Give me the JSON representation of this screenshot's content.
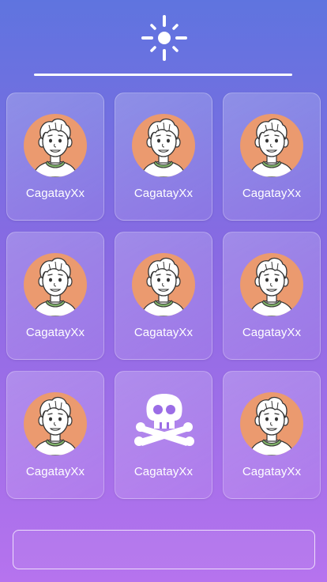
{
  "header": {
    "icon": "sun-icon",
    "divider": true
  },
  "players": [
    {
      "name": "CagatayXx",
      "avatar": "boy-avatar-icon",
      "status": "alive"
    },
    {
      "name": "CagatayXx",
      "avatar": "boy-avatar-icon",
      "status": "alive"
    },
    {
      "name": "CagatayXx",
      "avatar": "boy-avatar-icon",
      "status": "alive"
    },
    {
      "name": "CagatayXx",
      "avatar": "boy-avatar-icon",
      "status": "alive"
    },
    {
      "name": "CagatayXx",
      "avatar": "boy-avatar-icon",
      "status": "alive"
    },
    {
      "name": "CagatayXx",
      "avatar": "boy-avatar-icon",
      "status": "alive"
    },
    {
      "name": "CagatayXx",
      "avatar": "boy-avatar-icon",
      "status": "alive"
    },
    {
      "name": "CagatayXx",
      "avatar": "skull-crossbones-icon",
      "status": "dead"
    },
    {
      "name": "CagatayXx",
      "avatar": "boy-avatar-icon",
      "status": "alive"
    }
  ],
  "input": {
    "value": "",
    "placeholder": ""
  },
  "colors": {
    "gradient_top": "#5f74df",
    "gradient_bottom": "#b673ee",
    "avatar_bg": "#eb9a6f",
    "shirt": "#7fb069"
  }
}
